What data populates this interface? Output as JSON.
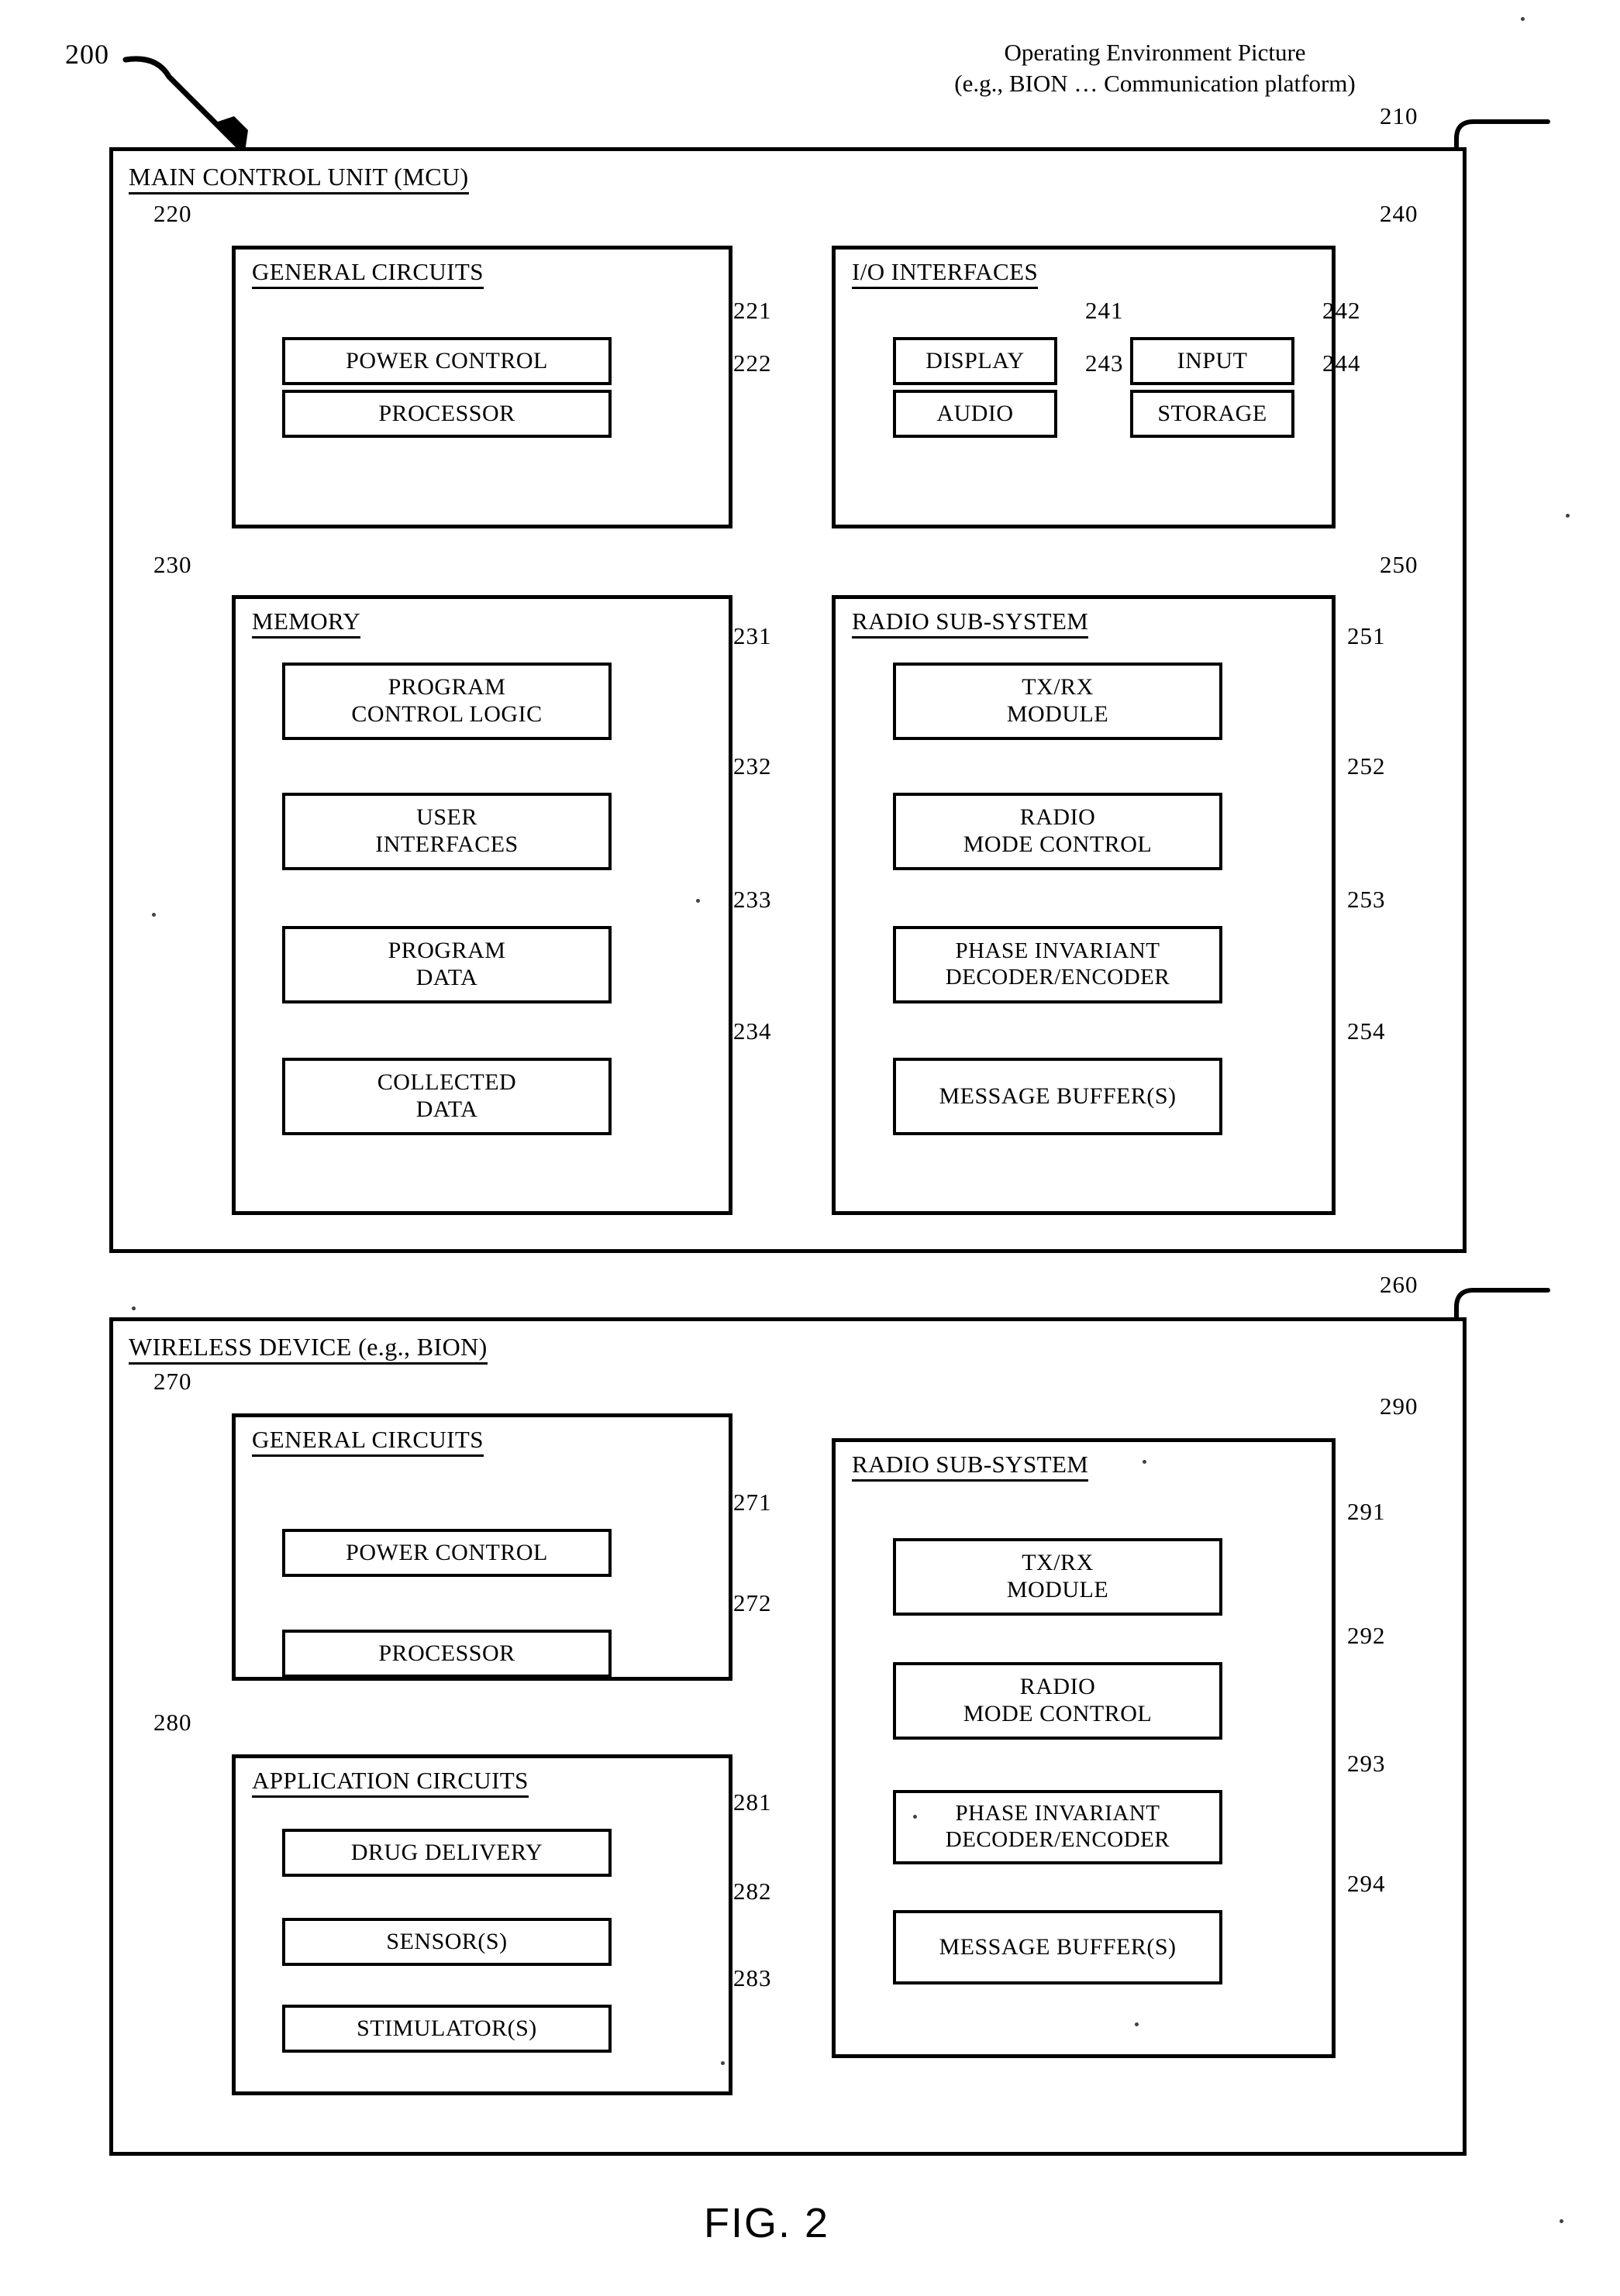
{
  "figure": {
    "caption": "FIG. 2",
    "top_label": "200",
    "header_caption": "Operating Environment Picture\n(e.g., BION … Communication platform)"
  },
  "mcu": {
    "ref": "210",
    "title": "MAIN CONTROL UNIT (MCU)",
    "general_circuits": {
      "ref": "220",
      "title": "GENERAL CIRCUITS",
      "items": [
        {
          "ref": "221",
          "label": "POWER CONTROL"
        },
        {
          "ref": "222",
          "label": "PROCESSOR"
        }
      ]
    },
    "io_interfaces": {
      "ref": "240",
      "title": "I/O INTERFACES",
      "items": [
        {
          "ref": "241",
          "label": "DISPLAY"
        },
        {
          "ref": "242",
          "label": "INPUT"
        },
        {
          "ref": "243",
          "label": "AUDIO"
        },
        {
          "ref": "244",
          "label": "STORAGE"
        }
      ]
    },
    "memory": {
      "ref": "230",
      "title": "MEMORY",
      "items": [
        {
          "ref": "231",
          "label": "PROGRAM\nCONTROL LOGIC"
        },
        {
          "ref": "232",
          "label": "USER\nINTERFACES"
        },
        {
          "ref": "233",
          "label": "PROGRAM\nDATA"
        },
        {
          "ref": "234",
          "label": "COLLECTED\nDATA"
        }
      ]
    },
    "radio_subsystem": {
      "ref": "250",
      "title": "RADIO SUB-SYSTEM",
      "items": [
        {
          "ref": "251",
          "label": "TX/RX\nMODULE"
        },
        {
          "ref": "252",
          "label": "RADIO\nMODE CONTROL"
        },
        {
          "ref": "253",
          "label": "PHASE INVARIANT\nDECODER/ENCODER"
        },
        {
          "ref": "254",
          "label": "MESSAGE BUFFER(S)"
        }
      ]
    }
  },
  "wireless_device": {
    "ref": "260",
    "title": "WIRELESS DEVICE (e.g., BION)",
    "general_circuits": {
      "ref": "270",
      "title": "GENERAL CIRCUITS",
      "items": [
        {
          "ref": "271",
          "label": "POWER CONTROL"
        },
        {
          "ref": "272",
          "label": "PROCESSOR"
        }
      ]
    },
    "application_circuits": {
      "ref": "280",
      "title": "APPLICATION CIRCUITS",
      "items": [
        {
          "ref": "281",
          "label": "DRUG DELIVERY"
        },
        {
          "ref": "282",
          "label": "SENSOR(S)"
        },
        {
          "ref": "283",
          "label": "STIMULATOR(S)"
        }
      ]
    },
    "radio_subsystem": {
      "ref": "290",
      "title": "RADIO SUB-SYSTEM",
      "items": [
        {
          "ref": "291",
          "label": "TX/RX\nMODULE"
        },
        {
          "ref": "292",
          "label": "RADIO\nMODE CONTROL"
        },
        {
          "ref": "293",
          "label": "PHASE INVARIANT\nDECODER/ENCODER"
        },
        {
          "ref": "294",
          "label": "MESSAGE BUFFER(S)"
        }
      ]
    }
  },
  "colors": {
    "ink": "#000000",
    "paper": "#ffffff"
  }
}
